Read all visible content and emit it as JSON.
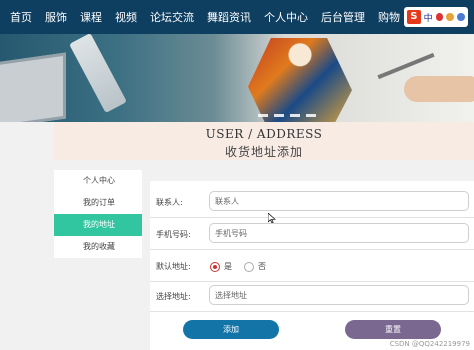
{
  "nav": {
    "items": [
      "首页",
      "服饰",
      "课程",
      "视频",
      "论坛交流",
      "舞蹈资讯",
      "个人中心",
      "后台管理",
      "购物"
    ]
  },
  "ime": {
    "logo": "S",
    "lang": "中"
  },
  "banner": {
    "slides_visible": 4
  },
  "page": {
    "title_en": "USER / ADDRESS",
    "title_zh": "收货地址添加"
  },
  "sidebar": {
    "items": [
      {
        "label": "个人中心",
        "active": false
      },
      {
        "label": "我的订单",
        "active": false
      },
      {
        "label": "我的地址",
        "active": true
      },
      {
        "label": "我的收藏",
        "active": false
      }
    ]
  },
  "form": {
    "contact_label": "联系人:",
    "contact_placeholder": "联系人",
    "phone_label": "手机号码:",
    "phone_placeholder": "手机号码",
    "default_label": "默认地址:",
    "default_yes": "是",
    "default_no": "否",
    "default_selected": "是",
    "address_label": "选择地址:",
    "address_placeholder": "选择地址",
    "add_button": "添加",
    "reset_button": "重置"
  },
  "watermark": "CSDN @QQ242219979",
  "colors": {
    "nav_bg": "#0f3f60",
    "active_item": "#31c6a0",
    "add_button": "#1374a8",
    "reset_button": "#7b6891"
  }
}
